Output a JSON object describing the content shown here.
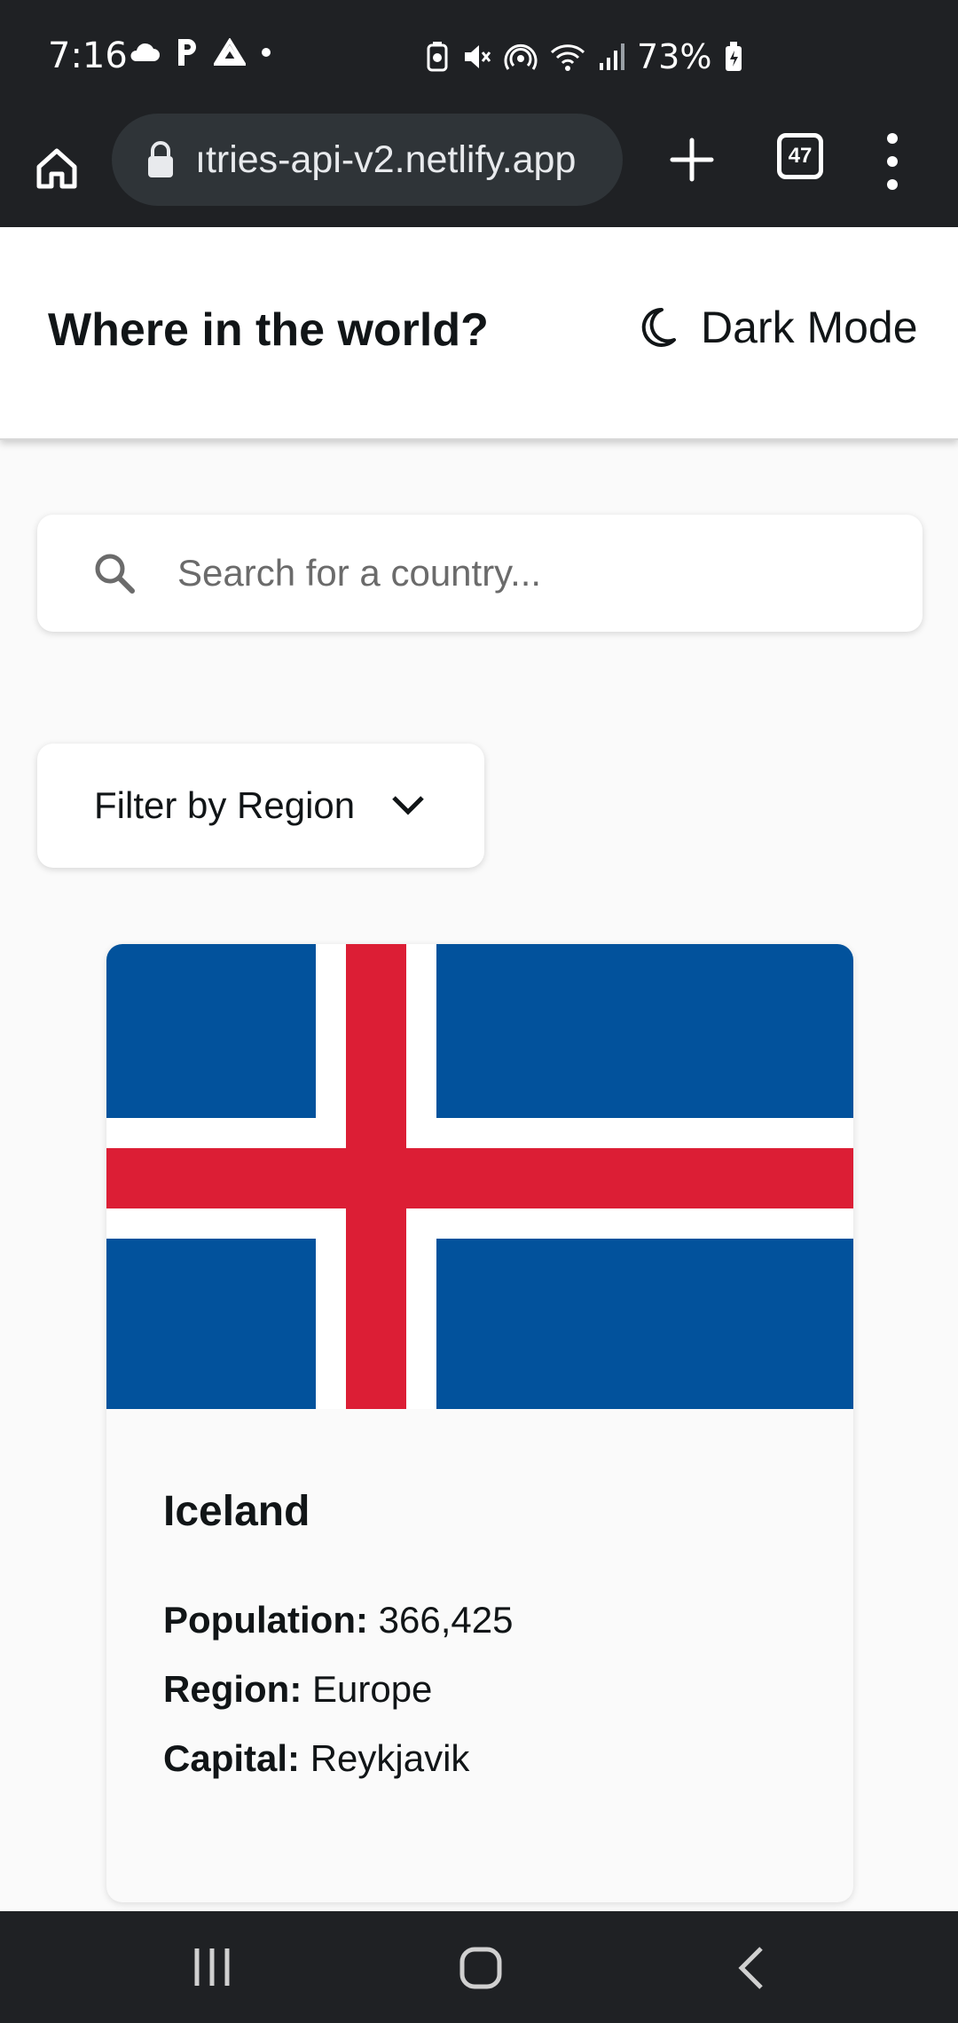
{
  "status_bar": {
    "time": "7:16",
    "battery": "73%",
    "icons": [
      "cloud-icon",
      "parking-icon",
      "drive-icon",
      "dot-icon",
      "battery-saver-icon",
      "mute-icon",
      "hotspot-icon",
      "wifi-icon",
      "signal-icon",
      "battery-icon"
    ]
  },
  "browser": {
    "url": "ıtries-api-v2.netlify.app",
    "tab_count": "47"
  },
  "header": {
    "title": "Where in the world?",
    "dark_mode_label": "Dark Mode"
  },
  "search": {
    "placeholder": "Search for a country..."
  },
  "filter": {
    "label": "Filter by Region"
  },
  "country": {
    "name": "Iceland",
    "population_label": "Population:",
    "population": "366,425",
    "region_label": "Region:",
    "region": "Europe",
    "capital_label": "Capital:",
    "capital": "Reykjavik"
  },
  "colors": {
    "flag_blue": "#02529c",
    "flag_red": "#dc1e35",
    "chrome_dark": "#1f2124"
  }
}
